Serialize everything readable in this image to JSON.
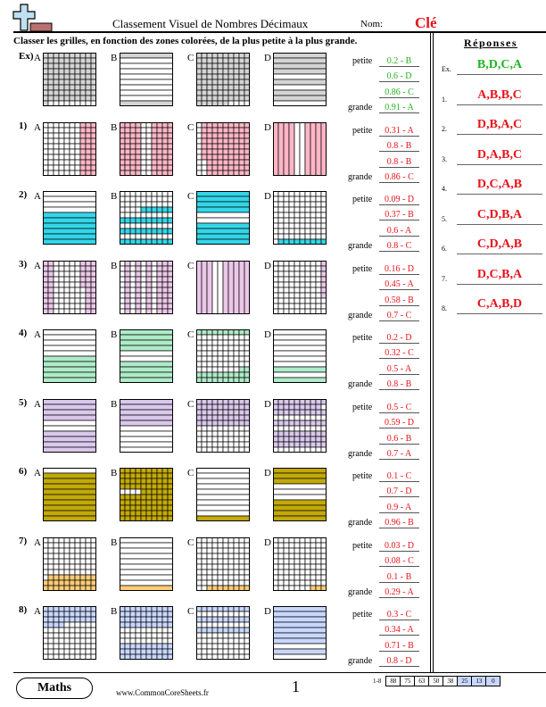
{
  "header": {
    "title": "Classement Visuel de Nombres Décimaux",
    "name_label": "Nom:",
    "name_value": "Clé",
    "instructions": "Classer les grilles, en fonction des zones colorées, de la plus petite à la plus grande."
  },
  "colors": {
    "key_red": "#e8121a",
    "example_green": "#1fb41f"
  },
  "order_words": {
    "first": "petite",
    "last": "grande"
  },
  "problems": [
    {
      "label": "Ex)",
      "color": "#d4d4d4",
      "answer_color": "#1fb41f",
      "grids": [
        {
          "letter": "A",
          "type": "hundred",
          "rows": [
            "1111111111",
            "1111111111",
            "1111111111",
            "1111111111",
            "1111111111",
            "1111111111",
            "1111111111",
            "1111111111",
            "1111111111",
            "1000000000"
          ]
        },
        {
          "letter": "B",
          "type": "rows",
          "rows": [
            "1",
            "0",
            "0",
            "0",
            "0",
            "0",
            "0",
            "0",
            "0",
            "1"
          ]
        },
        {
          "letter": "C",
          "type": "hundred",
          "rows": [
            "1111111111",
            "1111111111",
            "1111111111",
            "1111111111",
            "1111111111",
            "1111111111",
            "1111111111",
            "1111111111",
            "1111111111",
            "1111110000"
          ]
        },
        {
          "letter": "D",
          "type": "rows",
          "rows": [
            "1",
            "1",
            "1",
            "1",
            "0",
            "1",
            "0",
            "1",
            "1",
            "0"
          ]
        }
      ],
      "order": [
        "0.2 - B",
        "0.6 - D",
        "0.86 - C",
        "0.91 - A"
      ]
    },
    {
      "label": "1)",
      "color": "#ffb6c6",
      "answer_color": "#e8121a",
      "grids": [
        {
          "letter": "A",
          "type": "hundred",
          "rows": [
            "0000000111",
            "0000000111",
            "0000000111",
            "0000000111",
            "0000000111",
            "0000000111",
            "0000000111",
            "0000000111",
            "0000000111",
            "0000000111"
          ]
        },
        {
          "letter": "B",
          "type": "hundred",
          "rows": [
            "1111001111",
            "1111001111",
            "1111001111",
            "1111001111",
            "1111001111",
            "1111001111",
            "1111001111",
            "1111001111",
            "1111001111",
            "1111001111"
          ]
        },
        {
          "letter": "C",
          "type": "hundred",
          "rows": [
            "0111111111",
            "0111111111",
            "0111111111",
            "0111111111",
            "0111111111",
            "0111111111",
            "0111111111",
            "0011111111",
            "0011111111",
            "0011111111"
          ]
        },
        {
          "letter": "D",
          "type": "cols",
          "rows": [
            "1111001111"
          ]
        }
      ],
      "order": [
        "0.31 - A",
        "0.8 - B",
        "0.8 - B",
        "0.86 - C"
      ]
    },
    {
      "label": "2)",
      "color": "#33d6e8",
      "answer_color": "#e8121a",
      "grids": [
        {
          "letter": "A",
          "type": "rows",
          "rows": [
            "0",
            "0",
            "0",
            "0",
            "1",
            "1",
            "1",
            "1",
            "1",
            "1"
          ]
        },
        {
          "letter": "B",
          "type": "hundred",
          "rows": [
            "0000000000",
            "0000000000",
            "0000000000",
            "0000111111",
            "0000000000",
            "1111111111",
            "0000000000",
            "1111111111",
            "0000000000",
            "1111111111"
          ]
        },
        {
          "letter": "C",
          "type": "rows",
          "rows": [
            "1",
            "1",
            "1",
            "1",
            "0",
            "0",
            "1",
            "1",
            "1",
            "1"
          ]
        },
        {
          "letter": "D",
          "type": "hundred",
          "rows": [
            "0000000000",
            "0000000000",
            "0000000000",
            "0000000000",
            "0000000000",
            "0000000000",
            "0000000000",
            "0000000000",
            "0000000000",
            "0111111111"
          ]
        }
      ],
      "order": [
        "0.09 - D",
        "0.37 - B",
        "0.6 - A",
        "0.8 - C"
      ]
    },
    {
      "label": "3)",
      "color": "#ebc7e8",
      "answer_color": "#e8121a",
      "grids": [
        {
          "letter": "A",
          "type": "hundred",
          "rows": [
            "1100000111",
            "1100000111",
            "1100000111",
            "1100000111",
            "1100000111",
            "1100000011",
            "1100000011",
            "1100000011",
            "1100000011",
            "1100000011"
          ]
        },
        {
          "letter": "B",
          "type": "hundred",
          "rows": [
            "0101010111",
            "0101010111",
            "0101010111",
            "0101010111",
            "0101010111",
            "0101010111",
            "0101010111",
            "0101010111",
            "0101010111",
            "0101010111"
          ]
        },
        {
          "letter": "C",
          "type": "cols",
          "rows": [
            "1110011111"
          ]
        },
        {
          "letter": "D",
          "type": "hundred",
          "rows": [
            "0000000001",
            "0000000001",
            "0000000001",
            "0000000001",
            "0000000001",
            "0000000001",
            "0000000001",
            "0000000000",
            "0000000000",
            "0000000000"
          ]
        }
      ],
      "order": [
        "0.16 - D",
        "0.45 - A",
        "0.58 - B",
        "0.7 - C"
      ]
    },
    {
      "label": "4)",
      "color": "#aeebc8",
      "answer_color": "#e8121a",
      "grids": [
        {
          "letter": "A",
          "type": "rows",
          "rows": [
            "0",
            "0",
            "0",
            "0",
            "0",
            "1",
            "1",
            "1",
            "1",
            "1"
          ]
        },
        {
          "letter": "B",
          "type": "rows",
          "rows": [
            "1",
            "1",
            "1",
            "1",
            "0",
            "0",
            "1",
            "1",
            "1",
            "1"
          ]
        },
        {
          "letter": "C",
          "type": "hundred",
          "rows": [
            "1111111111",
            "0000000000",
            "0000000000",
            "0000000000",
            "0000000000",
            "0000000000",
            "0000000000",
            "0000000011",
            "1111111111",
            "1111111111"
          ]
        },
        {
          "letter": "D",
          "type": "rows",
          "rows": [
            "0",
            "0",
            "0",
            "0",
            "0",
            "0",
            "0",
            "1",
            "0",
            "1"
          ]
        }
      ],
      "order": [
        "0.2 - D",
        "0.32 - C",
        "0.5 - A",
        "0.8 - B"
      ]
    },
    {
      "label": "5)",
      "color": "#d9c8ec",
      "answer_color": "#e8121a",
      "grids": [
        {
          "letter": "A",
          "type": "rows",
          "rows": [
            "1",
            "1",
            "1",
            "1",
            "0",
            "0",
            "1",
            "1",
            "1",
            "1"
          ]
        },
        {
          "letter": "B",
          "type": "rows",
          "rows": [
            "1",
            "1",
            "1",
            "1",
            "1",
            "0",
            "0",
            "0",
            "0",
            "0"
          ]
        },
        {
          "letter": "C",
          "type": "hundred",
          "rows": [
            "1111111111",
            "1111111111",
            "1111111111",
            "1111111111",
            "1111111111",
            "0000000000",
            "0000000000",
            "0000000000",
            "0000000000",
            "0000000000"
          ]
        },
        {
          "letter": "D",
          "type": "hundred",
          "rows": [
            "1111111111",
            "1111111110",
            "1111111111",
            "0000000000",
            "1111111111",
            "0000000000",
            "1111111111",
            "1111111111",
            "1111111111",
            "0000000000"
          ]
        }
      ],
      "order": [
        "0.5 - C",
        "0.59 - D",
        "0.6 - B",
        "0.7 - A"
      ]
    },
    {
      "label": "6)",
      "color": "#c2a908",
      "answer_color": "#e8121a",
      "grids": [
        {
          "letter": "A",
          "type": "rows",
          "rows": [
            "0",
            "1",
            "1",
            "1",
            "1",
            "1",
            "1",
            "1",
            "1",
            "1"
          ]
        },
        {
          "letter": "B",
          "type": "hundred",
          "rows": [
            "1111111111",
            "1111111111",
            "1111111111",
            "1111111111",
            "0000111111",
            "1111111111",
            "1111111111",
            "1111111111",
            "1111111111",
            "1111111111"
          ]
        },
        {
          "letter": "C",
          "type": "rows",
          "rows": [
            "0",
            "0",
            "0",
            "0",
            "0",
            "0",
            "0",
            "0",
            "0",
            "1"
          ]
        },
        {
          "letter": "D",
          "type": "rows",
          "rows": [
            "1",
            "1",
            "1",
            "0",
            "0",
            "0",
            "1",
            "1",
            "1",
            "1"
          ]
        }
      ],
      "order": [
        "0.1 - C",
        "0.7 - D",
        "0.9 - A",
        "0.96 - B"
      ]
    },
    {
      "label": "7)",
      "color": "#ffcc77",
      "answer_color": "#e8121a",
      "grids": [
        {
          "letter": "A",
          "type": "hundred",
          "rows": [
            "0000000000",
            "0000000000",
            "0000000000",
            "0000000000",
            "0000000000",
            "0000000000",
            "0000000000",
            "0111111111",
            "1111111111",
            "1111111111"
          ]
        },
        {
          "letter": "B",
          "type": "rows",
          "rows": [
            "0",
            "0",
            "0",
            "0",
            "0",
            "0",
            "0",
            "0",
            "0",
            "1"
          ]
        },
        {
          "letter": "C",
          "type": "hundred",
          "rows": [
            "0000000000",
            "0000000000",
            "0000000000",
            "0000000000",
            "0000000000",
            "0000000000",
            "0000000000",
            "0000000000",
            "0000000000",
            "0011111111"
          ]
        },
        {
          "letter": "D",
          "type": "hundred",
          "rows": [
            "0000000000",
            "0000000000",
            "0000000000",
            "0000000000",
            "0000000000",
            "0000000000",
            "0000000000",
            "0000000000",
            "0000000000",
            "0000000111"
          ]
        }
      ],
      "order": [
        "0.03 - D",
        "0.08 - C",
        "0.1 - B",
        "0.29 - A"
      ]
    },
    {
      "label": "8)",
      "color": "#c9d7ff",
      "answer_color": "#e8121a",
      "grids": [
        {
          "letter": "A",
          "type": "hundred",
          "rows": [
            "1111111111",
            "1111111111",
            "1111111111",
            "1111000000",
            "0000000000",
            "0000000000",
            "0000000000",
            "0000000000",
            "0000000000",
            "0000000000"
          ]
        },
        {
          "letter": "B",
          "type": "hundred",
          "rows": [
            "1111111111",
            "1111111111",
            "1111111111",
            "1111111111",
            "0000000000",
            "0000000000",
            "0000000000",
            "1111111111",
            "1111111111",
            "1111111111"
          ]
        },
        {
          "letter": "C",
          "type": "hundred",
          "rows": [
            "1111111111",
            "0000000000",
            "1111111111",
            "0000000000",
            "1111111111",
            "0000000000",
            "0000000000",
            "0000000000",
            "0000000000",
            "0000000000"
          ]
        },
        {
          "letter": "D",
          "type": "rows",
          "rows": [
            "1",
            "1",
            "1",
            "1",
            "1",
            "1",
            "1",
            "0",
            "1",
            "0"
          ]
        }
      ],
      "order": [
        "0.3 - C",
        "0.34 - A",
        "0.71 - B",
        "0.8 - D"
      ]
    }
  ],
  "answers": {
    "heading": "Réponses",
    "items": [
      {
        "num": "Ex.",
        "value": "B,D,C,A",
        "color": "#1fb41f"
      },
      {
        "num": "1.",
        "value": "A,B,B,C",
        "color": "#e8121a"
      },
      {
        "num": "2.",
        "value": "D,B,A,C",
        "color": "#e8121a"
      },
      {
        "num": "3.",
        "value": "D,A,B,C",
        "color": "#e8121a"
      },
      {
        "num": "4.",
        "value": "D,C,A,B",
        "color": "#e8121a"
      },
      {
        "num": "5.",
        "value": "C,D,B,A",
        "color": "#e8121a"
      },
      {
        "num": "6.",
        "value": "C,D,A,B",
        "color": "#e8121a"
      },
      {
        "num": "7.",
        "value": "D,C,B,A",
        "color": "#e8121a"
      },
      {
        "num": "8.",
        "value": "C,A,B,D",
        "color": "#e8121a"
      }
    ]
  },
  "footer": {
    "subject": "Maths",
    "website": "www.CommonCoreSheets.fr",
    "page": "1",
    "score_label": "1-8",
    "scores": [
      {
        "v": "88",
        "hl": false
      },
      {
        "v": "75",
        "hl": false
      },
      {
        "v": "63",
        "hl": false
      },
      {
        "v": "50",
        "hl": false
      },
      {
        "v": "38",
        "hl": false
      },
      {
        "v": "25",
        "hl": true
      },
      {
        "v": "13",
        "hl": true
      },
      {
        "v": "0",
        "hl": true
      }
    ]
  }
}
